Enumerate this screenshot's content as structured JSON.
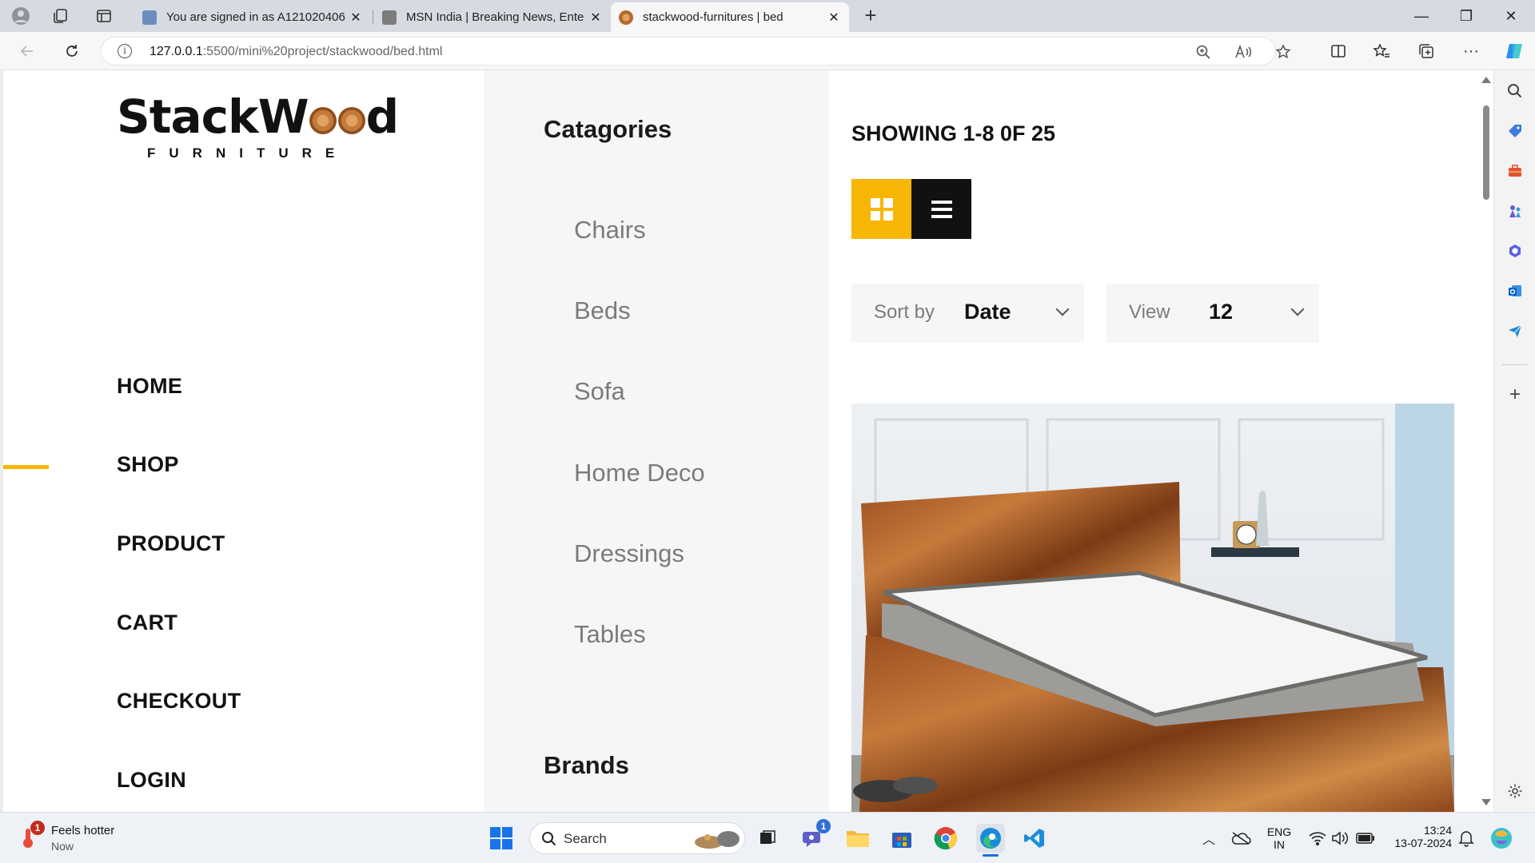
{
  "browser": {
    "tabs": [
      {
        "title": "You are signed in as A121020406",
        "close": "✕"
      },
      {
        "title": "MSN India | Breaking News, Ente",
        "close": "✕"
      },
      {
        "title": "stackwood-furnitures | bed",
        "close": "✕"
      }
    ],
    "new_tab": "+",
    "window_controls": {
      "minimize": "—",
      "maximize": "❐",
      "close": "✕"
    },
    "url_host": "127.0.0.1",
    "url_path": ":5500/mini%20project/stackwood/bed.html"
  },
  "site": {
    "logo_word_left": "StackW",
    "logo_word_right": "d",
    "logo_sub": "FURNITURE",
    "nav": [
      "HOME",
      "SHOP",
      "PRODUCT",
      "CART",
      "CHECKOUT",
      "LOGIN"
    ],
    "active_nav": "SHOP",
    "categories_heading": "Catagories",
    "categories": [
      "Chairs",
      "Beds",
      "Sofa",
      "Home Deco",
      "Dressings",
      "Tables"
    ],
    "brands_heading": "Brands",
    "showing_text": "SHOWING 1-8 0F 25",
    "sort": {
      "label": "Sort by",
      "value": "Date"
    },
    "view": {
      "label": "View",
      "value": "12"
    },
    "accent_color": "#f8b604"
  },
  "taskbar": {
    "weather_title": "Feels hotter",
    "weather_sub": "Now",
    "weather_badge": "1",
    "search_placeholder": "Search",
    "teams_badge": "1",
    "lang_top": "ENG",
    "lang_bottom": "IN",
    "time": "13:24",
    "date": "13-07-2024"
  }
}
